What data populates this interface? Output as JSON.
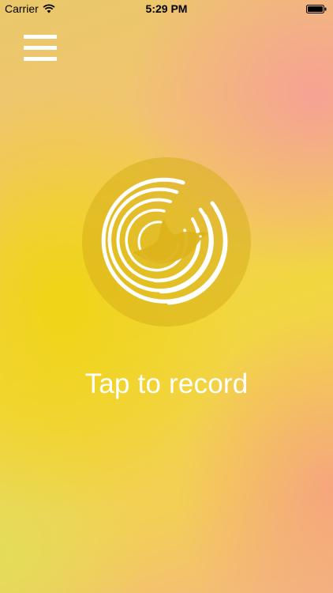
{
  "status_bar": {
    "carrier": "Carrier",
    "time": "5:29 PM",
    "wifi_icon": "wifi-icon",
    "battery_icon": "battery-icon"
  },
  "menu": {
    "icon": "hamburger-menu-icon"
  },
  "record": {
    "icon": "bird-sound-waves-icon",
    "prompt": "Tap to record"
  },
  "colors": {
    "text": "#ffffff",
    "record_circle": "#d7af19",
    "background_yellow": "#f2d640",
    "background_pink": "#f6a096"
  }
}
